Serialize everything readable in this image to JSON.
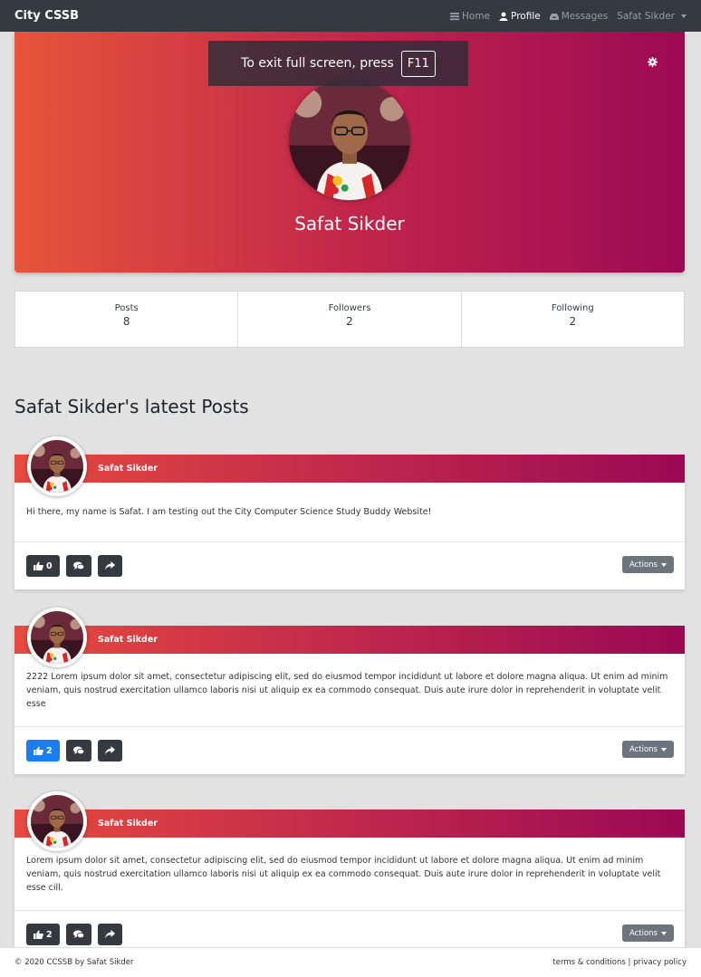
{
  "navbar": {
    "brand": "City CSSB",
    "links": [
      {
        "label": "Home",
        "icon": "bars-icon",
        "active": false
      },
      {
        "label": "Profile",
        "icon": "user-icon",
        "active": true
      },
      {
        "label": "Messages",
        "icon": "inbox-icon",
        "active": false
      }
    ],
    "user_menu": "Safat Sikder"
  },
  "fullscreen_toast": {
    "text": "To exit full screen, press",
    "key": "F11"
  },
  "profile": {
    "name": "Safat Sikder"
  },
  "stats": [
    {
      "label": "Posts",
      "value": "8"
    },
    {
      "label": "Followers",
      "value": "2"
    },
    {
      "label": "Following",
      "value": "2"
    }
  ],
  "section_title": "Safat Sikder's latest Posts",
  "posts": [
    {
      "author": "Safat Sikder",
      "body": "Hi there, my name is Safat. I am testing out the City Computer Science Study Buddy Website!",
      "likes": "0",
      "liked": false,
      "actions_label": "Actions"
    },
    {
      "author": "Safat Sikder",
      "body": "2222 Lorem ipsum dolor sit amet, consectetur adipiscing elit, sed do eiusmod tempor incididunt ut labore et dolore magna aliqua. Ut enim ad minim veniam, quis nostrud exercitation ullamco laboris nisi ut aliquip ex ea commodo consequat. Duis aute irure dolor in reprehenderit in voluptate velit esse",
      "likes": "2",
      "liked": true,
      "actions_label": "Actions"
    },
    {
      "author": "Safat Sikder",
      "body": "Lorem ipsum dolor sit amet, consectetur adipiscing elit, sed do eiusmod tempor incididunt ut labore et dolore magna aliqua. Ut enim ad minim veniam, quis nostrud exercitation ullamco laboris nisi ut aliquip ex ea commodo consequat. Duis aute irure dolor in reprehenderit in voluptate velit esse cill.",
      "likes": "2",
      "liked": false,
      "actions_label": "Actions"
    }
  ],
  "footer": {
    "copyright": "© 2020 CCSSB by Safat Sikder",
    "links": "terms & conditions | privacy policy"
  },
  "colors": {
    "navbar": "#343a40",
    "gradient_start": "#e7553a",
    "gradient_end": "#9c0a54",
    "liked_button": "#1a7ef0",
    "actions_button": "#6c757d"
  }
}
